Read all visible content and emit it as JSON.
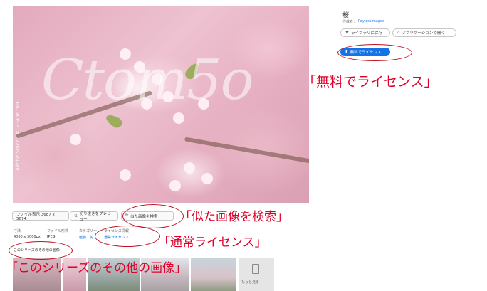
{
  "page": {
    "title": "桜",
    "author_label": "作成者：",
    "author_name": "Paylessimages",
    "library_button": "ライブラリに保存",
    "app_button": "アプリケーションで開く",
    "license_button": "無料でライセンス",
    "photo_watermark": "Ctom5o",
    "photo_credit": "Adobe Stock | #123456789"
  },
  "actions": {
    "filesize_button": "ファイル表示 3687 x 5674",
    "edit_button": "切り抜きをプレビュー",
    "similar_button": "似た画像を検索"
  },
  "meta": {
    "col1_label": "寸法",
    "col1_value": "4000 x 3000px",
    "col2_label": "ファイル形式",
    "col2_value": "JPEG",
    "col3_label": "カテゴリー",
    "col3_value": "植物・花",
    "col4_label": "ライセンス情報",
    "col4_value": "通常ライセンス",
    "series_link": "このシリーズのその他の画像"
  },
  "more": {
    "label": "もっと見る"
  },
  "annotations": {
    "license": "「無料でライセンス」",
    "similar": "「似た画像を検索」",
    "standard": "「通常ライセンス」",
    "series": "「このシリーズのその他の画像」"
  },
  "colors": {
    "accent": "#1473e6",
    "annotation": "#e0002a"
  }
}
